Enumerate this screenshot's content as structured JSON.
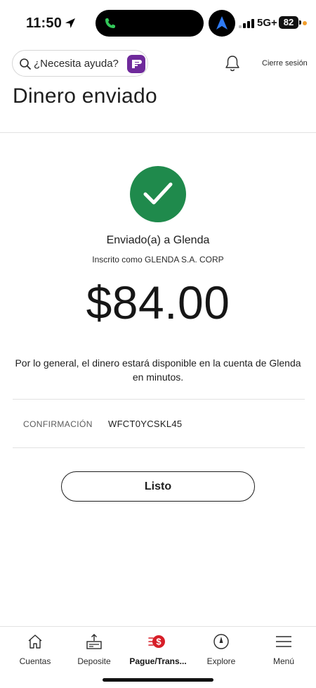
{
  "status_bar": {
    "time": "11:50",
    "network": "5G+",
    "battery": "82"
  },
  "header": {
    "search_placeholder": "¿Necesita ayuda?",
    "logout_label": "Cierre sesión",
    "icons": [
      "search-icon",
      "fargo-assistant-icon",
      "bell-icon"
    ]
  },
  "page": {
    "title": "Dinero enviado"
  },
  "confirmation": {
    "sent_to": "Enviado(a) a Glenda",
    "enrolled_as": "Inscrito como GLENDA S.A. CORP",
    "amount": "$84.00",
    "availability_note": "Por lo general, el dinero estará disponible en la cuenta de Glenda en minutos.",
    "confirmation_label": "CONFIRMACIÓN",
    "confirmation_number": "WFCT0YCSKL45",
    "done_label": "Listo"
  },
  "tabbar": {
    "items": [
      {
        "label": "Cuentas",
        "icon": "home-icon"
      },
      {
        "label": "Deposite",
        "icon": "deposit-icon"
      },
      {
        "label": "Pague/Trans...",
        "icon": "pay-transfer-icon",
        "active": true
      },
      {
        "label": "Explore",
        "icon": "compass-icon"
      },
      {
        "label": "Menú",
        "icon": "menu-icon"
      }
    ]
  },
  "colors": {
    "success_green": "#1f8a4c",
    "accent_red": "#d71e28",
    "assistant_purple": "#6f2a9b"
  }
}
